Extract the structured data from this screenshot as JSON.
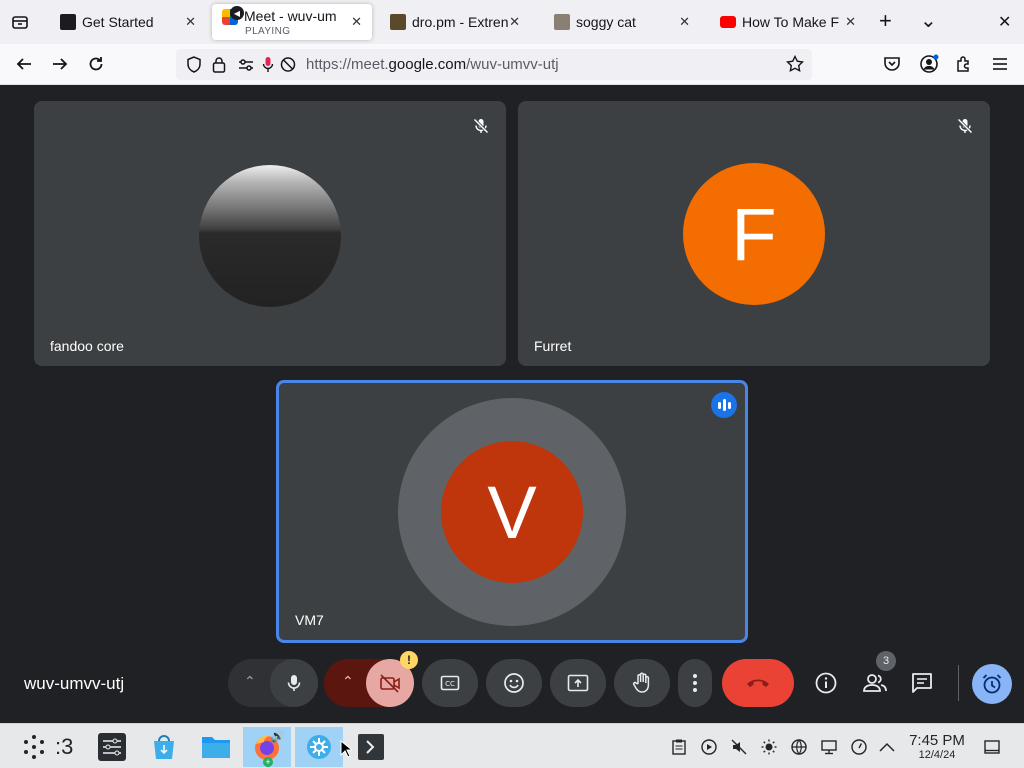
{
  "browser": {
    "tabs": [
      {
        "title": "Get Started",
        "active": false
      },
      {
        "title": "Meet - wuv-um",
        "subtitle": "PLAYING",
        "active": true
      },
      {
        "title": "dro.pm - Extren",
        "active": false
      },
      {
        "title": "soggy cat",
        "active": false
      },
      {
        "title": "How To Make F",
        "active": false
      }
    ],
    "new_tab_glyph": "+",
    "tab_list_glyph": "⌄",
    "close_window_glyph": "✕",
    "url": {
      "prefix": "https://meet.",
      "domain": "google.com",
      "path": "/wuv-umvv-utj"
    }
  },
  "meet": {
    "participants": [
      {
        "name": "fandoo core",
        "muted": true
      },
      {
        "name": "Furret",
        "initial": "F",
        "muted": true,
        "avatar_color": "#f46d00"
      },
      {
        "name": "VM7",
        "initial": "V",
        "speaking": true,
        "avatar_color": "#bf360c"
      }
    ],
    "meeting_code": "wuv-umvv-utj",
    "people_count": "3",
    "warning_badge": "!"
  },
  "taskbar": {
    "workspace_label": ":3",
    "time": "7:45 PM",
    "date": "12/4/24"
  },
  "colors": {
    "meet_bg": "#202124",
    "tile_bg": "#3c4043",
    "end_call": "#ea4335",
    "accent_blue": "#8ab4f8",
    "speaking_border": "#4a86e8"
  }
}
